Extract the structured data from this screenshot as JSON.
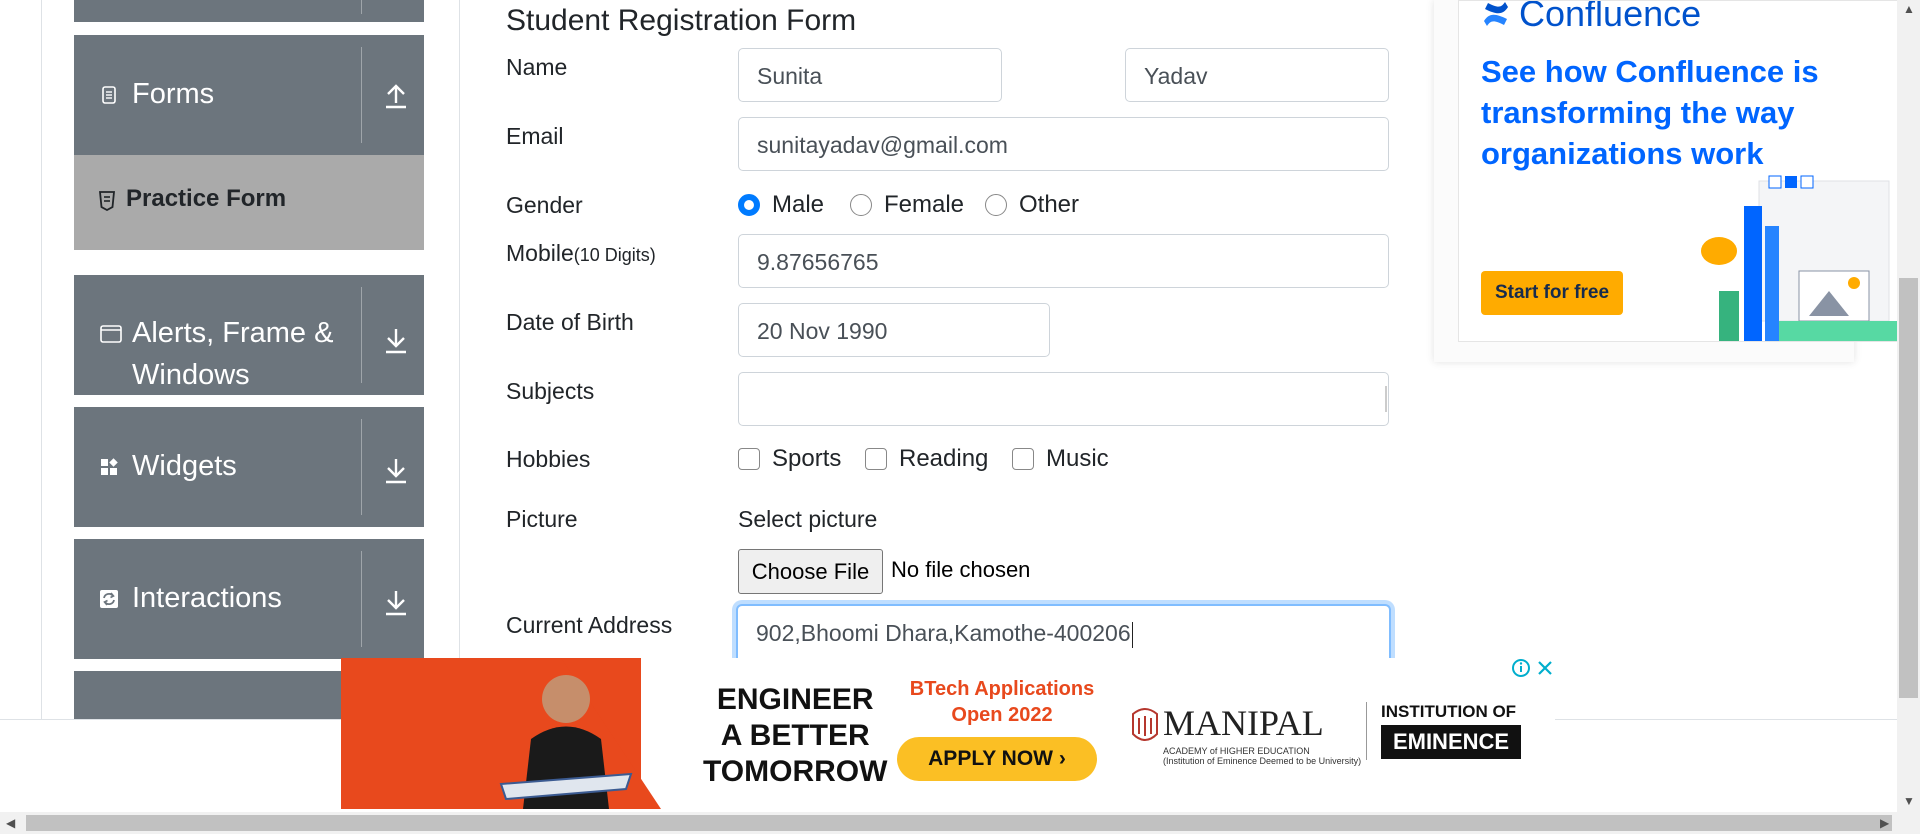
{
  "sidebar": {
    "groups": [
      {
        "label": "Forms",
        "icon": "document-icon",
        "arrow": "upload-arrow-icon"
      },
      {
        "label": "Alerts, Frame &",
        "label2": "Windows",
        "icon": "window-icon",
        "arrow": "download-arrow-icon"
      },
      {
        "label": "Widgets",
        "icon": "widgets-icon",
        "arrow": "download-arrow-icon"
      },
      {
        "label": "Interactions",
        "icon": "interactions-icon",
        "arrow": "download-arrow-icon"
      }
    ],
    "active_item": {
      "label": "Practice Form",
      "icon": "html5-icon"
    }
  },
  "form": {
    "title": "Student Registration Form",
    "labels": {
      "name": "Name",
      "email": "Email",
      "gender": "Gender",
      "mobile": "Mobile",
      "mobile_hint": "(10 Digits)",
      "dob": "Date of Birth",
      "subjects": "Subjects",
      "hobbies": "Hobbies",
      "picture": "Picture",
      "address": "Current Address"
    },
    "first_name": "Sunita",
    "last_name": "Yadav",
    "email": "sunitayadav@gmail.com",
    "gender_options": [
      "Male",
      "Female",
      "Other"
    ],
    "gender_selected": "Male",
    "mobile": "9.87656765",
    "dob": "20 Nov 1990",
    "subjects": "",
    "hobbies": [
      "Sports",
      "Reading",
      "Music"
    ],
    "picture_label": "Select picture",
    "choose_file": "Choose File",
    "no_file": "No file chosen",
    "address": "902,Bhoomi Dhara,Kamothe-400206"
  },
  "ad_right": {
    "brand": "Confluence",
    "headline": "See how Confluence is transforming the way organizations work",
    "cta": "Start for free"
  },
  "ad_bottom": {
    "headline": [
      "ENGINEER",
      "A BETTER",
      "TOMORROW"
    ],
    "btech": [
      "BTech Applications",
      "Open 2022"
    ],
    "apply": "APPLY NOW ›",
    "university": "MANIPAL",
    "university_sub": "ACADEMY of HIGHER EDUCATION",
    "university_sub2": "(Institution of Eminence Deemed to be University)",
    "institution": "INSTITUTION OF",
    "eminence": "EMINENCE"
  },
  "colors": {
    "sidebar_group": "#6c757d",
    "active_item": "#aaaaaa",
    "radio_checked": "#007bff",
    "focus_border": "#80bdff",
    "confluence_blue": "#0065ff",
    "cta_yellow": "#ffab00"
  }
}
